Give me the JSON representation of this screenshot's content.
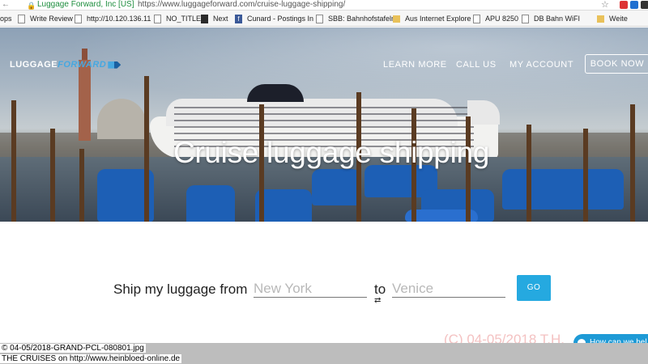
{
  "browser": {
    "site_identity": "Luggage Forward, Inc [US]",
    "url": "https://www.luggageforward.com/cruise-luggage-shipping/"
  },
  "bookmarks": [
    {
      "label": "ops",
      "icon": "none"
    },
    {
      "label": "Write Review",
      "icon": "page"
    },
    {
      "label": "http://10.120.136.11",
      "icon": "page"
    },
    {
      "label": "NO_TITLE",
      "icon": "page"
    },
    {
      "label": "Next",
      "icon": "dark"
    },
    {
      "label": "Cunard - Postings In",
      "icon": "facebook"
    },
    {
      "label": "SBB: Bahnhofstafeln",
      "icon": "page"
    },
    {
      "label": "Aus Internet Explore",
      "icon": "folder"
    },
    {
      "label": "APU 8250",
      "icon": "page"
    },
    {
      "label": "DB Bahn WiFI",
      "icon": "page"
    },
    {
      "label": "Weite",
      "icon": "folder"
    }
  ],
  "header": {
    "logo_part1": "LUGGAGE",
    "logo_part2": "FORWARD",
    "nav": [
      "LEARN MORE",
      "CALL US",
      "MY ACCOUNT"
    ],
    "book_now": "BOOK NOW"
  },
  "hero": {
    "title": "Cruise luggage shipping"
  },
  "form": {
    "label": "Ship my luggage from",
    "from_placeholder": "New York",
    "to_label": "to",
    "to_placeholder": "Venice",
    "go_label": "GO"
  },
  "overlay": {
    "watermark": "(C) 04-05/2018 T.H.",
    "chat_label": "How can we hel",
    "caption_line1": "© 04-05/2018-GRAND-PCL-080801.jpg",
    "caption_line2": "THE CRUISES on http://www.heinbloed-online.de"
  },
  "colors": {
    "accent_blue": "#25a9e0",
    "logo_blue": "#47a8e0",
    "secure_green": "#1e8e3e"
  }
}
